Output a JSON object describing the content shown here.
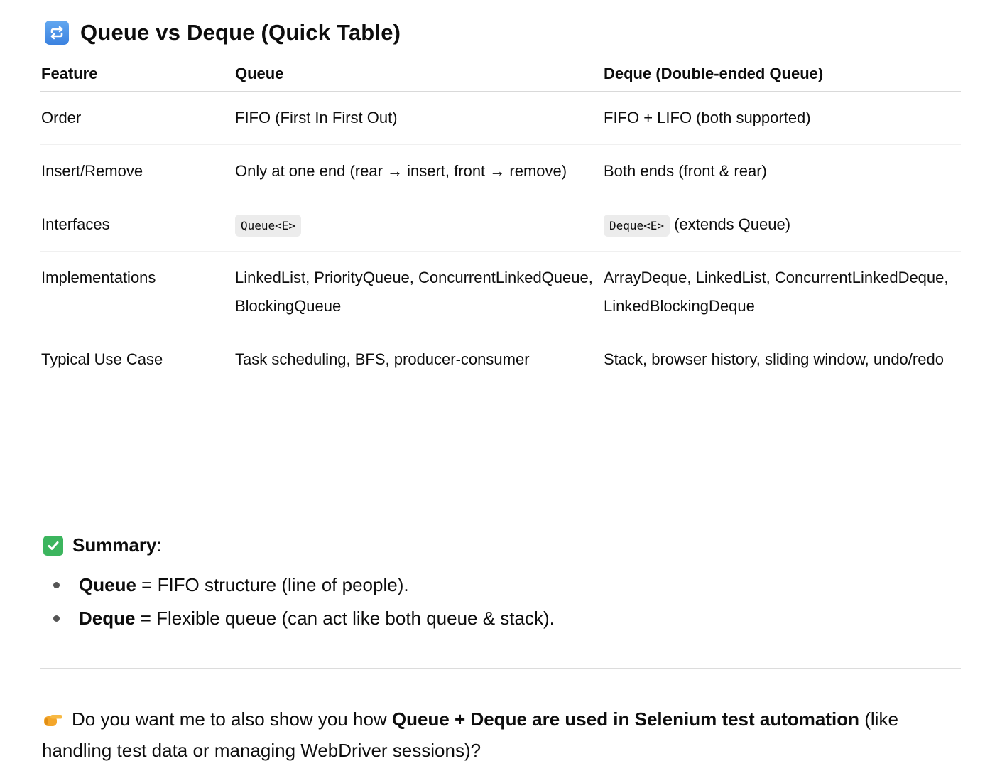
{
  "heading": {
    "icon": "repeat-arrows-icon",
    "title": "Queue vs Deque (Quick Table)"
  },
  "table": {
    "headers": [
      "Feature",
      "Queue",
      "Deque (Double-ended Queue)"
    ],
    "rows": [
      [
        "Order",
        "FIFO (First In First Out)",
        "FIFO + LIFO (both supported)"
      ],
      [
        "Insert/Remove",
        "Only at one end (rear → insert, front → remove)",
        "Both ends (front & rear)"
      ],
      [
        "Interfaces",
        "Queue<E>",
        "Deque<E>"
      ],
      [
        "Implementations",
        "LinkedList, PriorityQueue, ConcurrentLinkedQueue, BlockingQueue",
        "ArrayDeque, LinkedList, ConcurrentLinkedDeque, LinkedBlockingDeque"
      ],
      [
        "Typical Use Case",
        "Task scheduling, BFS, producer-consumer",
        "Stack, browser history, sliding window, undo/redo"
      ]
    ],
    "interfaces_deque_note": "(extends Queue)"
  },
  "summary": {
    "icon": "check-mark-icon",
    "label": "Summary",
    "colon": ":",
    "items": [
      {
        "term": "Queue",
        "sep": " = ",
        "desc": "FIFO structure (line of people)."
      },
      {
        "term": "Deque",
        "sep": " = ",
        "desc": "Flexible queue (can act like both queue & stack)."
      }
    ]
  },
  "question": {
    "icon": "pointing-hand-icon",
    "pre": "Do you want me to also show you how ",
    "bold": "Queue + Deque are used in Selenium test automation",
    "post": " (like handling test data or managing WebDriver sessions)?"
  },
  "colors": {
    "text": "#0d0d0d",
    "rule": "#dcdcdc",
    "code_bg": "#ececec",
    "check_green": "#3cb55e",
    "repeat_blue": "#3b82e0"
  }
}
